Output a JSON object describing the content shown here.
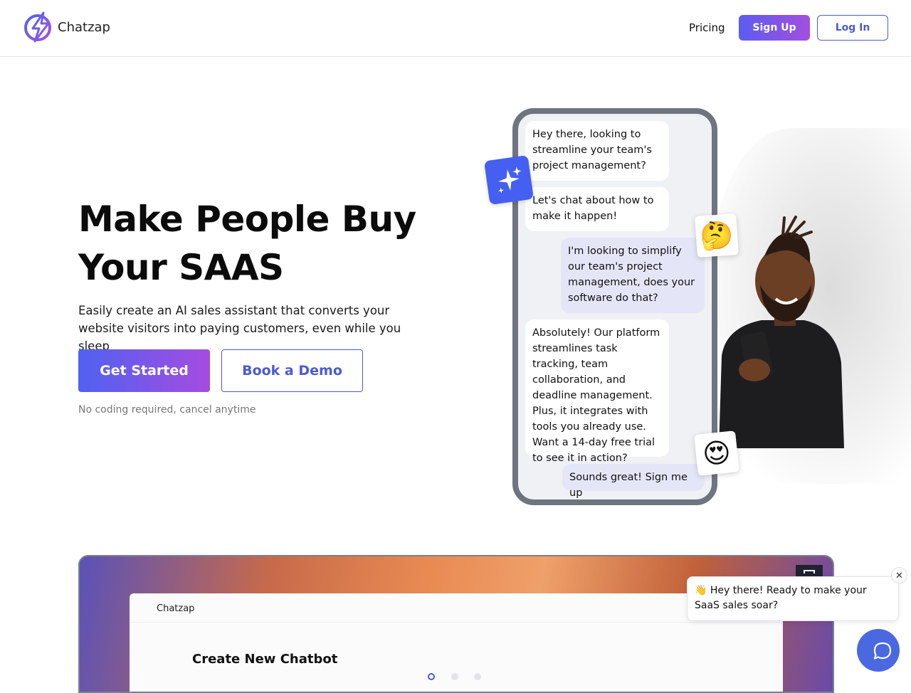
{
  "header": {
    "brand": "Chatzap",
    "nav_pricing": "Pricing",
    "signup_label": "Sign Up",
    "login_label": "Log In"
  },
  "hero": {
    "title_line1": "Make People Buy",
    "title_line2": "Your SAAS",
    "subtitle": "Easily create an AI sales assistant that converts your website visitors into paying customers, even while you sleep",
    "cta_primary": "Get Started",
    "cta_secondary": "Book a Demo",
    "note": "No coding required, cancel anytime"
  },
  "chat_demo": {
    "messages": [
      {
        "from": "bot",
        "text": "Hey there, looking to streamline your team's project management?"
      },
      {
        "from": "bot",
        "text": "Let's chat about how to make it happen!"
      },
      {
        "from": "user",
        "text": "I'm looking to simplify our team's project management, does your software do that?"
      },
      {
        "from": "bot",
        "text": "Absolutely! Our platform streamlines task tracking, team collaboration, and deadline management. Plus, it integrates with tools you already use. Want a 14-day free trial to see it in action?"
      },
      {
        "from": "user",
        "text": "Sounds great! Sign me up"
      }
    ],
    "emoji_thinking": "🤔",
    "emoji_love": "😍"
  },
  "product_demo": {
    "app_brand": "Chatzap",
    "heading": "Create New Chatbot",
    "carousel_active_index": 0,
    "carousel_count": 3
  },
  "chat_widget": {
    "greeting": "👋 Hey there! Ready to make your SaaS sales soar?",
    "close_symbol": "✕"
  },
  "colors": {
    "accent": "#4a5bd0",
    "gradient_start": "#4f62f2",
    "gradient_end": "#a54ce0",
    "launcher": "#4a68e0"
  }
}
